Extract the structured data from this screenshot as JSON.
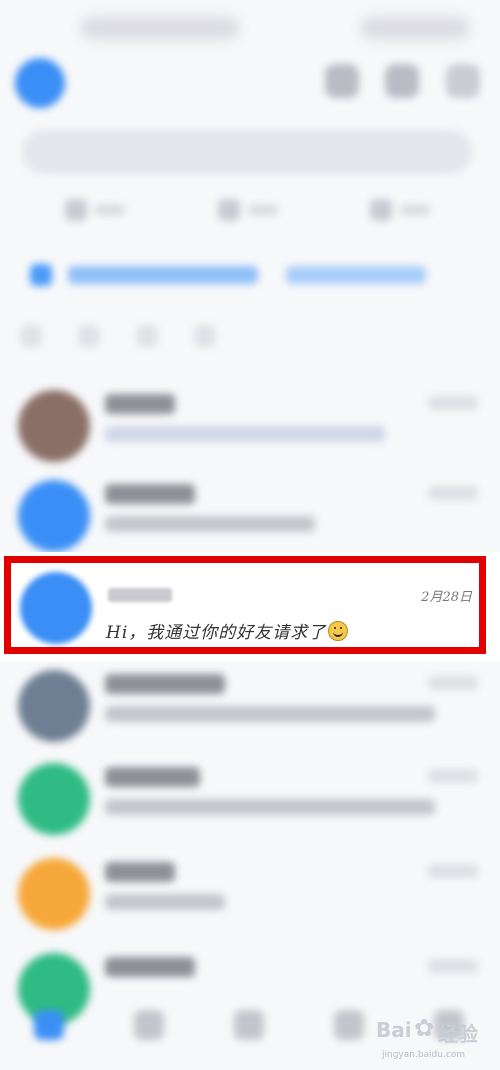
{
  "highlighted_chat": {
    "time": "2月28日",
    "message": "Hi，我通过你的好友请求了",
    "emoji": "smiley-face"
  },
  "watermark": {
    "brand_left": "Bai",
    "brand_right": "经验",
    "url": "jingyan.baidu.com"
  },
  "colors": {
    "accent": "#3a8ef6",
    "highlight_border": "#e00000"
  },
  "icons": {
    "top_right": [
      "search-icon",
      "more-icon",
      "add-icon"
    ],
    "tabbar": [
      "message-icon",
      "contacts-icon",
      "discover-icon",
      "space-icon",
      "me-icon"
    ]
  }
}
